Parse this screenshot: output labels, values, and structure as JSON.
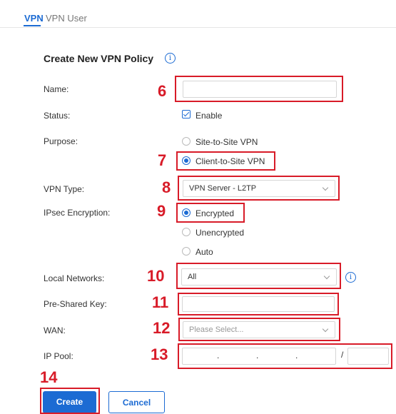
{
  "tabs": [
    {
      "label": "VPN"
    },
    {
      "label": "VPN User"
    }
  ],
  "form": {
    "title": "Create New VPN Policy",
    "name": {
      "label": "Name:",
      "value": ""
    },
    "status": {
      "label": "Status:",
      "checkbox_label": "Enable",
      "checked": true
    },
    "purpose": {
      "label": "Purpose:",
      "options": [
        "Site-to-Site VPN",
        "Client-to-Site VPN"
      ],
      "selected": "Client-to-Site VPN"
    },
    "vpn_type": {
      "label": "VPN Type:",
      "value": "VPN Server - L2TP"
    },
    "ipsec": {
      "label": "IPsec Encryption:",
      "options": [
        "Encrypted",
        "Unencrypted",
        "Auto"
      ],
      "selected": "Encrypted"
    },
    "local_networks": {
      "label": "Local Networks:",
      "value": "All"
    },
    "pre_shared_key": {
      "label": "Pre-Shared Key:",
      "value": ""
    },
    "wan": {
      "label": "WAN:",
      "placeholder": "Please Select..."
    },
    "ip_pool": {
      "label": "IP Pool:",
      "separators": [
        ".",
        ".",
        "."
      ],
      "slash": "/"
    }
  },
  "buttons": {
    "create": "Create",
    "cancel": "Cancel"
  },
  "annotations": [
    "6",
    "7",
    "8",
    "9",
    "10",
    "11",
    "12",
    "13",
    "14"
  ],
  "colors": {
    "accent": "#1c6bd3",
    "annotation_red": "#d81b28"
  }
}
